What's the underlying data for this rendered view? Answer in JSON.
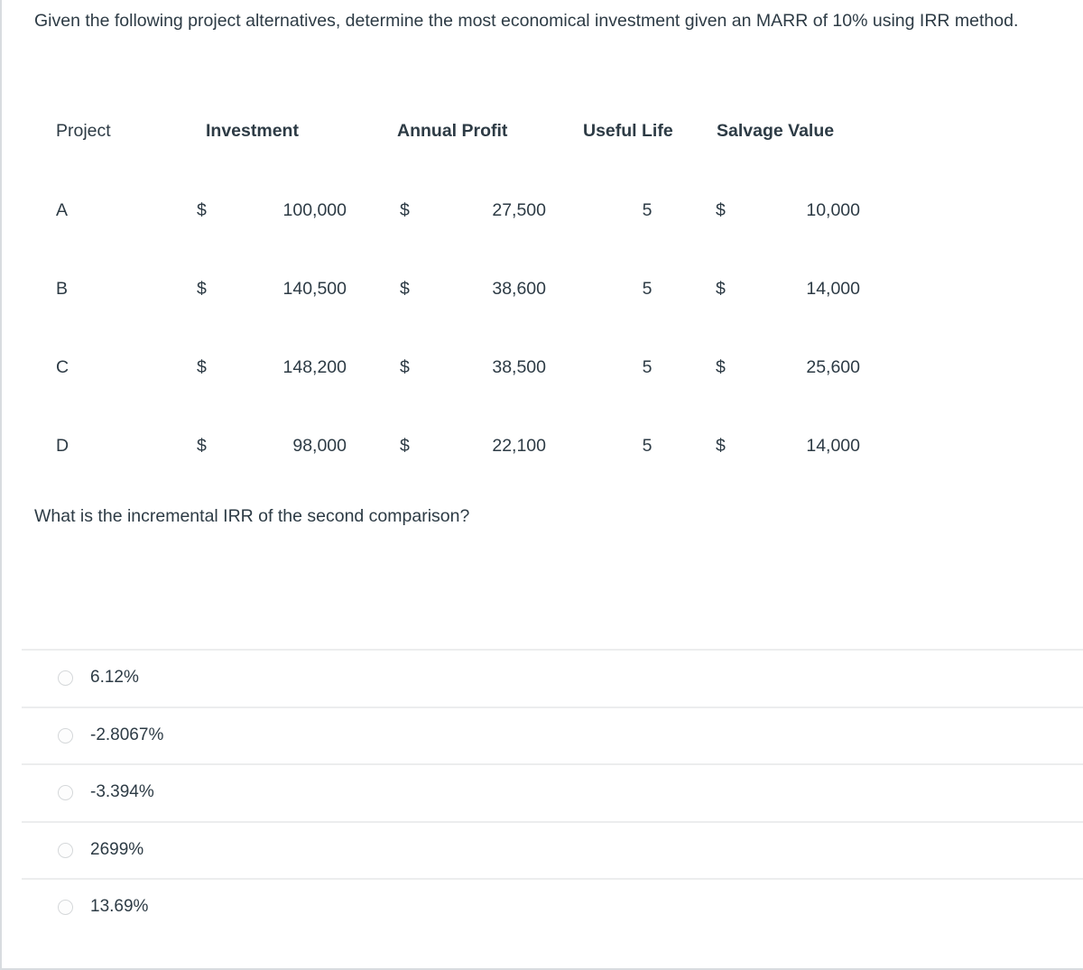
{
  "question": {
    "stem": "Given the following project alternatives, determine the most economical investment given an MARR of 10% using IRR method.",
    "sub_question": "What is the incremental IRR of the second comparison?"
  },
  "table": {
    "headers": {
      "project": "Project",
      "investment": "Investment",
      "annual_profit": "Annual Profit",
      "useful_life": "Useful Life",
      "salvage_value": "Salvage Value"
    },
    "currency_symbol": "$",
    "rows": [
      {
        "project": "A",
        "investment_symbol": "$",
        "investment": "100,000",
        "profit_symbol": "$",
        "annual_profit": "27,500",
        "useful_life": "5",
        "salvage_symbol": "$",
        "salvage_value": "10,000"
      },
      {
        "project": "B",
        "investment_symbol": "$",
        "investment": "140,500",
        "profit_symbol": "$",
        "annual_profit": "38,600",
        "useful_life": "5",
        "salvage_symbol": "$",
        "salvage_value": "14,000"
      },
      {
        "project": "C",
        "investment_symbol": "$",
        "investment": "148,200",
        "profit_symbol": "$",
        "annual_profit": "38,500",
        "useful_life": "5",
        "salvage_symbol": "$",
        "salvage_value": "25,600"
      },
      {
        "project": "D",
        "investment_symbol": "$",
        "investment": "98,000",
        "profit_symbol": "$",
        "annual_profit": "22,100",
        "useful_life": "5",
        "salvage_symbol": "$",
        "salvage_value": "14,000"
      }
    ]
  },
  "answers": {
    "selected": null,
    "options": [
      {
        "label": "6.12%"
      },
      {
        "label": "-2.8067%"
      },
      {
        "label": "-3.394%"
      },
      {
        "label": "2699%"
      },
      {
        "label": "13.69%"
      }
    ]
  },
  "colors": {
    "text": "#2d3b45",
    "divider": "#ecedee",
    "page_border": "#d8dce0",
    "radio_border": "#d5d8da",
    "background": "#ffffff"
  }
}
